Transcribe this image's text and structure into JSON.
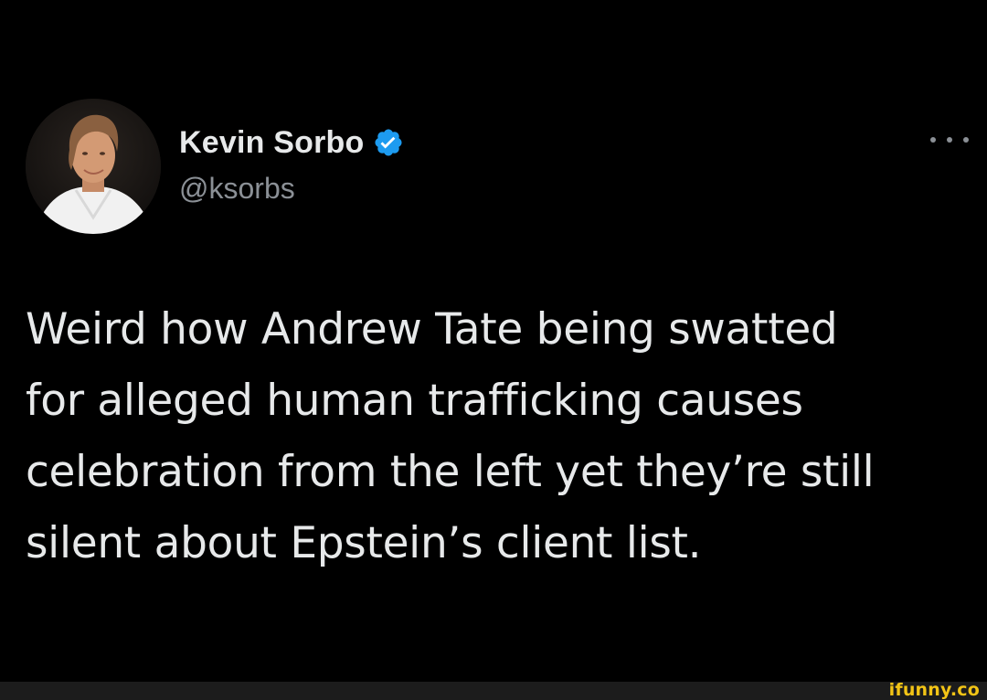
{
  "tweet": {
    "author": {
      "display_name": "Kevin Sorbo",
      "handle": "@ksorbs",
      "verified": true,
      "avatar_icon": "profile-photo"
    },
    "more_icon": "more-options-icon",
    "text": "Weird how Andrew Tate being swatted\nfor alleged human trafficking causes\ncelebration from the left yet they’re still\nsilent about Epstein’s client list."
  },
  "watermark": {
    "text": "ifunny.co"
  },
  "colors": {
    "background": "#000000",
    "primary_text": "#e7e9ea",
    "secondary_text": "#8b9096",
    "verified_blue": "#1d9bf0",
    "watermark_yellow": "#f2c416"
  }
}
